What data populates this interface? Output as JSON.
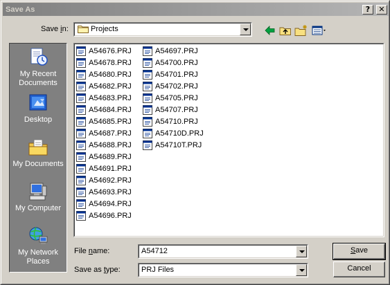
{
  "window": {
    "title": "Save As"
  },
  "titlebar": {
    "help_label": "?",
    "close_label": "✕"
  },
  "save_in": {
    "label_pre": "Save ",
    "label_accel": "i",
    "label_post": "n:",
    "value": "Projects"
  },
  "toolbar": {
    "back": "back-icon",
    "up": "up-folder-icon",
    "new_folder": "new-folder-icon",
    "views": "views-menu-icon"
  },
  "places": [
    {
      "label": "My Recent Documents",
      "icon": "recent-documents-icon"
    },
    {
      "label": "Desktop",
      "icon": "desktop-icon"
    },
    {
      "label": "My Documents",
      "icon": "my-documents-icon"
    },
    {
      "label": "My Computer",
      "icon": "my-computer-icon"
    },
    {
      "label": "My Network Places",
      "icon": "network-places-icon"
    }
  ],
  "files": {
    "column1": [
      "A54676.PRJ",
      "A54678.PRJ",
      "A54680.PRJ",
      "A54682.PRJ",
      "A54683.PRJ",
      "A54684.PRJ",
      "A54685.PRJ",
      "A54687.PRJ",
      "A54688.PRJ",
      "A54689.PRJ",
      "A54691.PRJ",
      "A54692.PRJ",
      "A54693.PRJ",
      "A54694.PRJ",
      "A54696.PRJ"
    ],
    "column2": [
      "A54697.PRJ",
      "A54700.PRJ",
      "A54701.PRJ",
      "A54702.PRJ",
      "A54705.PRJ",
      "A54707.PRJ",
      "A54710.PRJ",
      "A54710D.PRJ",
      "A54710T.PRJ"
    ]
  },
  "file_name": {
    "label_pre": "File ",
    "label_accel": "n",
    "label_post": "ame:",
    "value": "A54712"
  },
  "save_as_type": {
    "label_pre": "Save as ",
    "label_accel": "t",
    "label_post": "ype:",
    "value": "PRJ Files"
  },
  "buttons": {
    "save_accel": "S",
    "save_rest": "ave",
    "cancel": "Cancel"
  }
}
